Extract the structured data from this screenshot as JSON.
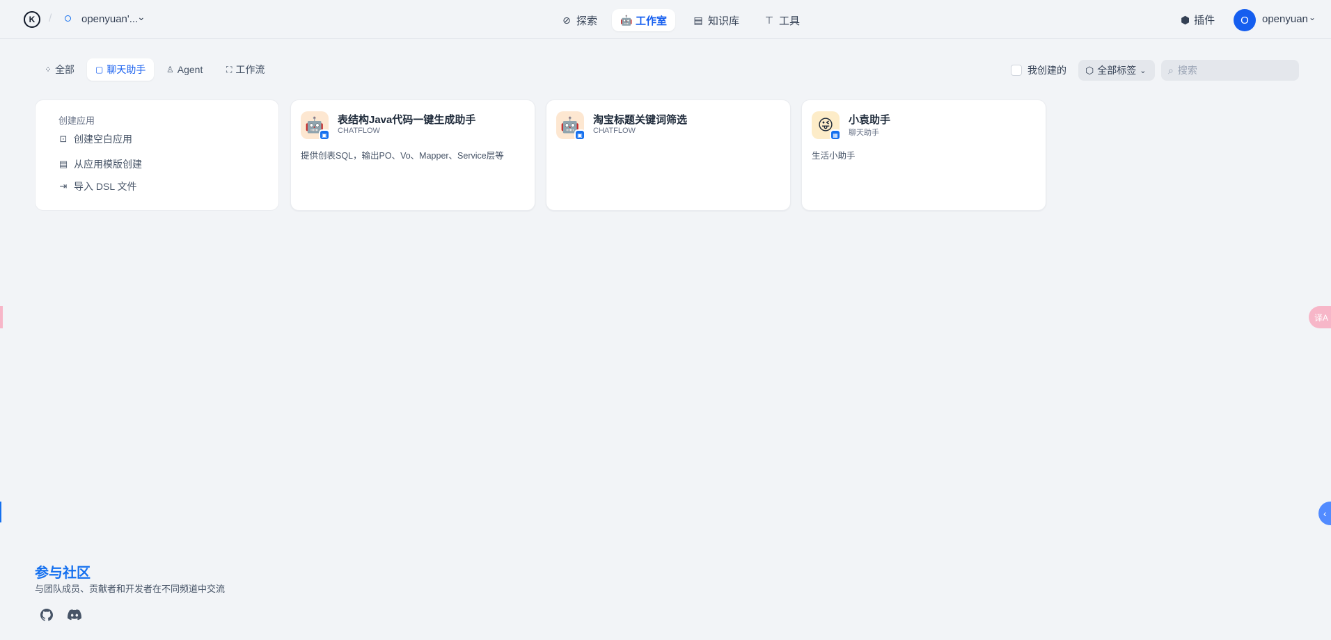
{
  "header": {
    "workspace_name": "openyuan'...",
    "nav": [
      {
        "label": "探索",
        "icon": "compass-icon"
      },
      {
        "label": "工作室",
        "icon": "robot-icon"
      },
      {
        "label": "知识库",
        "icon": "book-icon"
      },
      {
        "label": "工具",
        "icon": "hammer-icon"
      }
    ],
    "plugins_label": "插件",
    "avatar_initial": "O",
    "username": "openyuan"
  },
  "tabs": [
    {
      "label": "全部",
      "icon": "grid-icon"
    },
    {
      "label": "聊天助手",
      "icon": "chat-bot-icon"
    },
    {
      "label": "Agent",
      "icon": "agent-icon"
    },
    {
      "label": "工作流",
      "icon": "workflow-icon"
    }
  ],
  "filters": {
    "mine_label": "我创建的",
    "tags_label": "全部标签",
    "search_placeholder": "搜索"
  },
  "create": {
    "title": "创建应用",
    "items": [
      {
        "label": "创建空白应用",
        "icon": "new-file-icon"
      },
      {
        "label": "从应用模版创建",
        "icon": "template-icon"
      },
      {
        "label": "导入 DSL 文件",
        "icon": "import-icon"
      }
    ]
  },
  "apps": [
    {
      "name": "表结构Java代码一键生成助手",
      "type": "CHATFLOW",
      "desc": "提供创表SQL，输出PO、Vo、Mapper、Service层等",
      "icon": "robot-emoji-icon"
    },
    {
      "name": "淘宝标题关键词筛选",
      "type": "CHATFLOW",
      "desc": "",
      "icon": "robot-emoji-icon"
    },
    {
      "name": "小袁助手",
      "type": "聊天助手",
      "desc": "生活小助手",
      "icon": "smiley-emoji-icon"
    }
  ],
  "community": {
    "title": "参与社区",
    "subtitle": "与团队成员、贡献者和开发者在不同频道中交流"
  },
  "colors": {
    "accent": "#155eef",
    "background": "#f2f4f7",
    "card": "#ffffff"
  }
}
